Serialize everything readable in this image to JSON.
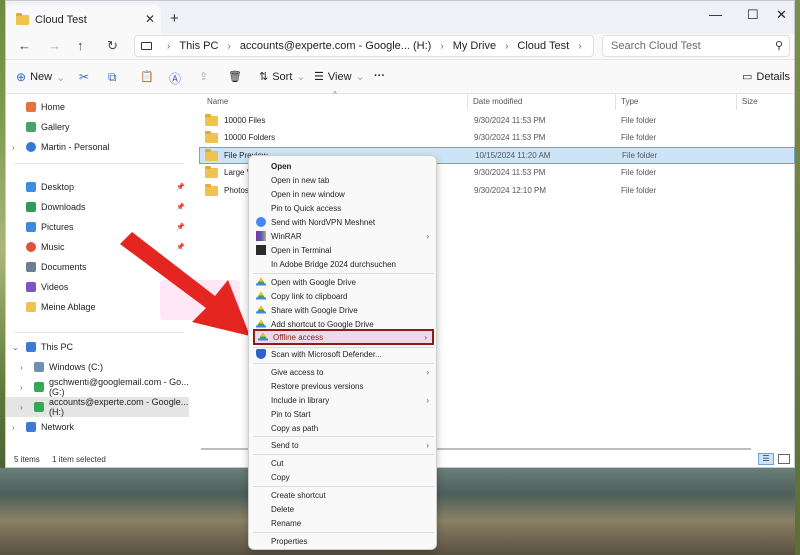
{
  "window": {
    "tab_title": "Cloud Test",
    "tab_close": "✕",
    "tab_add": "+",
    "minimize": "—",
    "maximize": "☐",
    "close": "✕"
  },
  "addressbar": {
    "breadcrumbs": [
      "This PC",
      "accounts@experte.com - Google... (H:)",
      "My Drive",
      "Cloud Test"
    ],
    "search_placeholder": "Search Cloud Test"
  },
  "toolbar": {
    "new_label": "New",
    "sort_label": "Sort",
    "view_label": "View",
    "more_label": "···",
    "details_label": "Details"
  },
  "sidebar": {
    "items": [
      {
        "label": "Home",
        "icon": "home-icon",
        "color": "#e8703a"
      },
      {
        "label": "Gallery",
        "icon": "gallery-icon",
        "color": "#4aa36b"
      },
      {
        "label": "Martin - Personal",
        "icon": "cloud-icon",
        "color": "#2f7bd8"
      },
      {
        "label": "Desktop",
        "icon": "desktop-icon",
        "color": "#3b8ee0"
      },
      {
        "label": "Downloads",
        "icon": "download-icon",
        "color": "#2d9b5e"
      },
      {
        "label": "Pictures",
        "icon": "pictures-icon",
        "color": "#3c8be0"
      },
      {
        "label": "Music",
        "icon": "music-icon",
        "color": "#e0533b"
      },
      {
        "label": "Documents",
        "icon": "documents-icon",
        "color": "#6b7f95"
      },
      {
        "label": "Videos",
        "icon": "videos-icon",
        "color": "#7a55c9"
      },
      {
        "label": "Meine Ablage",
        "icon": "folder-icon",
        "color": "#f0c24f"
      },
      {
        "label": "This PC",
        "icon": "pc-icon",
        "color": "#3d7ad6"
      },
      {
        "label": "Windows (C:)",
        "icon": "drive-icon",
        "color": "#6f8fb5"
      },
      {
        "label": "gschwenti@googlemail.com - Go... (G:)",
        "icon": "google-drive-icon",
        "color": "#34a853"
      },
      {
        "label": "accounts@experte.com - Google... (H:)",
        "icon": "google-drive-icon",
        "color": "#34a853"
      },
      {
        "label": "Network",
        "icon": "network-icon",
        "color": "#3d7ad6"
      }
    ]
  },
  "columns": {
    "name": "Name",
    "date": "Date modified",
    "type": "Type",
    "size": "Size"
  },
  "files": [
    {
      "name": "10000 Files",
      "date": "9/30/2024 11:53 PM",
      "type": "File folder"
    },
    {
      "name": "10000 Folders",
      "date": "9/30/2024 11:53 PM",
      "type": "File folder"
    },
    {
      "name": "File Preview",
      "date": "10/15/2024 11:20 AM",
      "type": "File folder"
    },
    {
      "name": "Large Videos",
      "date": "9/30/2024 11:53 PM",
      "type": "File folder"
    },
    {
      "name": "Photos",
      "date": "9/30/2024 12:10 PM",
      "type": "File folder"
    }
  ],
  "status": {
    "count": "5 items",
    "selected": "1 item selected"
  },
  "context_menu": {
    "items": [
      {
        "label": "Open",
        "bold": true
      },
      {
        "label": "Open in new tab"
      },
      {
        "label": "Open in new window"
      },
      {
        "label": "Pin to Quick access"
      },
      {
        "label": "Send with NordVPN Meshnet",
        "icon": "nordvpn-icon"
      },
      {
        "label": "WinRAR",
        "icon": "winrar-icon",
        "submenu": true
      },
      {
        "label": "Open in Terminal",
        "icon": "terminal-icon"
      },
      {
        "label": "In Adobe Bridge 2024 durchsuchen"
      },
      {
        "label": "Open with Google Drive",
        "icon": "google-drive-icon"
      },
      {
        "label": "Copy link to clipboard",
        "icon": "google-drive-icon"
      },
      {
        "label": "Share with Google Drive",
        "icon": "google-drive-icon"
      },
      {
        "label": "Add shortcut to Google Drive",
        "icon": "google-drive-icon"
      },
      {
        "label": "Offline access",
        "icon": "google-drive-icon",
        "submenu": true,
        "highlighted": true
      },
      {
        "label": "Scan with Microsoft Defender...",
        "icon": "defender-icon"
      },
      {
        "label": "Give access to",
        "submenu": true
      },
      {
        "label": "Restore previous versions"
      },
      {
        "label": "Include in library",
        "submenu": true
      },
      {
        "label": "Pin to Start"
      },
      {
        "label": "Copy as path"
      },
      {
        "label": "Send to",
        "submenu": true
      },
      {
        "label": "Cut"
      },
      {
        "label": "Copy"
      },
      {
        "label": "Create shortcut"
      },
      {
        "label": "Delete"
      },
      {
        "label": "Rename"
      },
      {
        "label": "Properties"
      }
    ]
  },
  "colors": {
    "highlight_border": "#8a1e14",
    "annotation_arrow": "#e5251f",
    "selection": "#cce4f7"
  }
}
